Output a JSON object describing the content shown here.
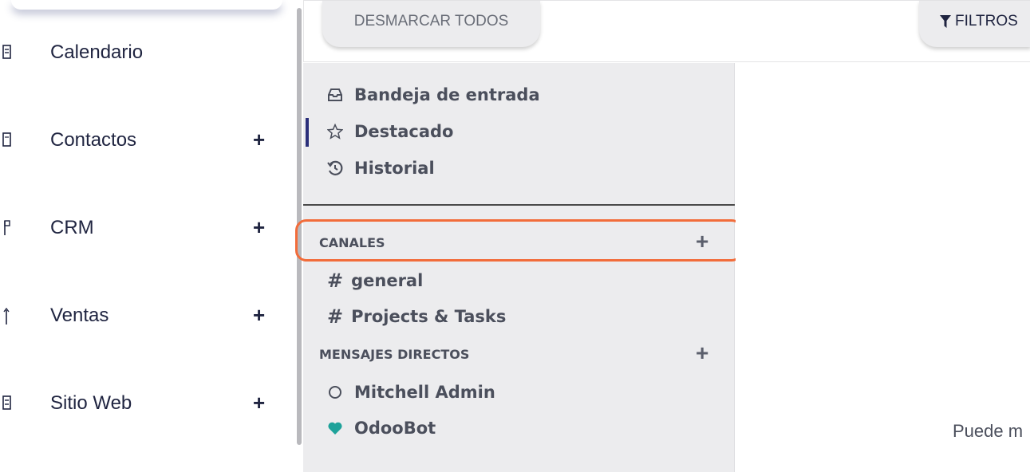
{
  "app_menu": {
    "items": [
      {
        "label": "Calendario",
        "has_add": false
      },
      {
        "label": "Contactos",
        "has_add": true
      },
      {
        "label": "CRM",
        "has_add": true
      },
      {
        "label": "Ventas",
        "has_add": true
      },
      {
        "label": "Sitio Web",
        "has_add": true
      }
    ],
    "add_symbol": "+"
  },
  "control_bar": {
    "unstar_all_label": "DESMARCAR TODOS",
    "filters_label": "FILTROS"
  },
  "sidebar": {
    "mailboxes": [
      {
        "label": "Bandeja de entrada",
        "icon": "inbox-icon"
      },
      {
        "label": "Destacado",
        "icon": "star-icon",
        "active": true
      },
      {
        "label": "Historial",
        "icon": "history-icon"
      }
    ],
    "channels_header": "CANALES",
    "channels": [
      {
        "label": "general"
      },
      {
        "label": "Projects & Tasks"
      }
    ],
    "direct_messages_header": "MENSAJES DIRECTOS",
    "direct_messages": [
      {
        "label": "Mitchell Admin",
        "icon": "offline-status-icon"
      },
      {
        "label": "OdooBot",
        "icon": "heart-icon"
      }
    ],
    "add_symbol": "+",
    "hash_symbol": "#"
  },
  "content": {
    "hint_text": "Puede m"
  },
  "colors": {
    "highlight": "#f26c3a",
    "active_marker": "#2b2f7a",
    "odoobot_heart": "#1ea29a"
  }
}
